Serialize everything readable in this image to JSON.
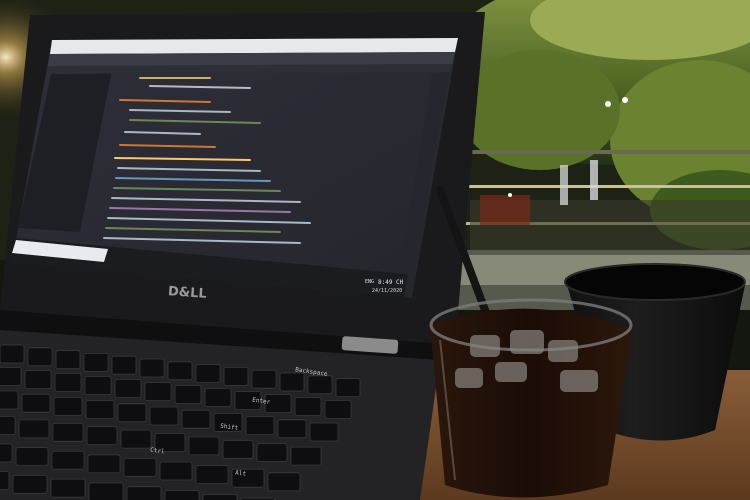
{
  "laptop": {
    "brand_logo": "D&LL",
    "screen": {
      "taskbar": {
        "language": "ENG",
        "time": "8:49 CH",
        "date": "24/11/2020"
      }
    }
  },
  "keyboard": {
    "key_labels": [
      "Backspace",
      "Enter",
      "Shift",
      "Ctrl",
      "Alt"
    ]
  },
  "colors": {
    "ide_background": "#2b2b33",
    "ide_sidebar": "#1e1f24",
    "taskbar": "#1b1c20",
    "foliage": "#5f7a2e",
    "drink": "#1a0d07"
  },
  "icons": {
    "start": "windows-start-icon",
    "search": "search-icon"
  }
}
